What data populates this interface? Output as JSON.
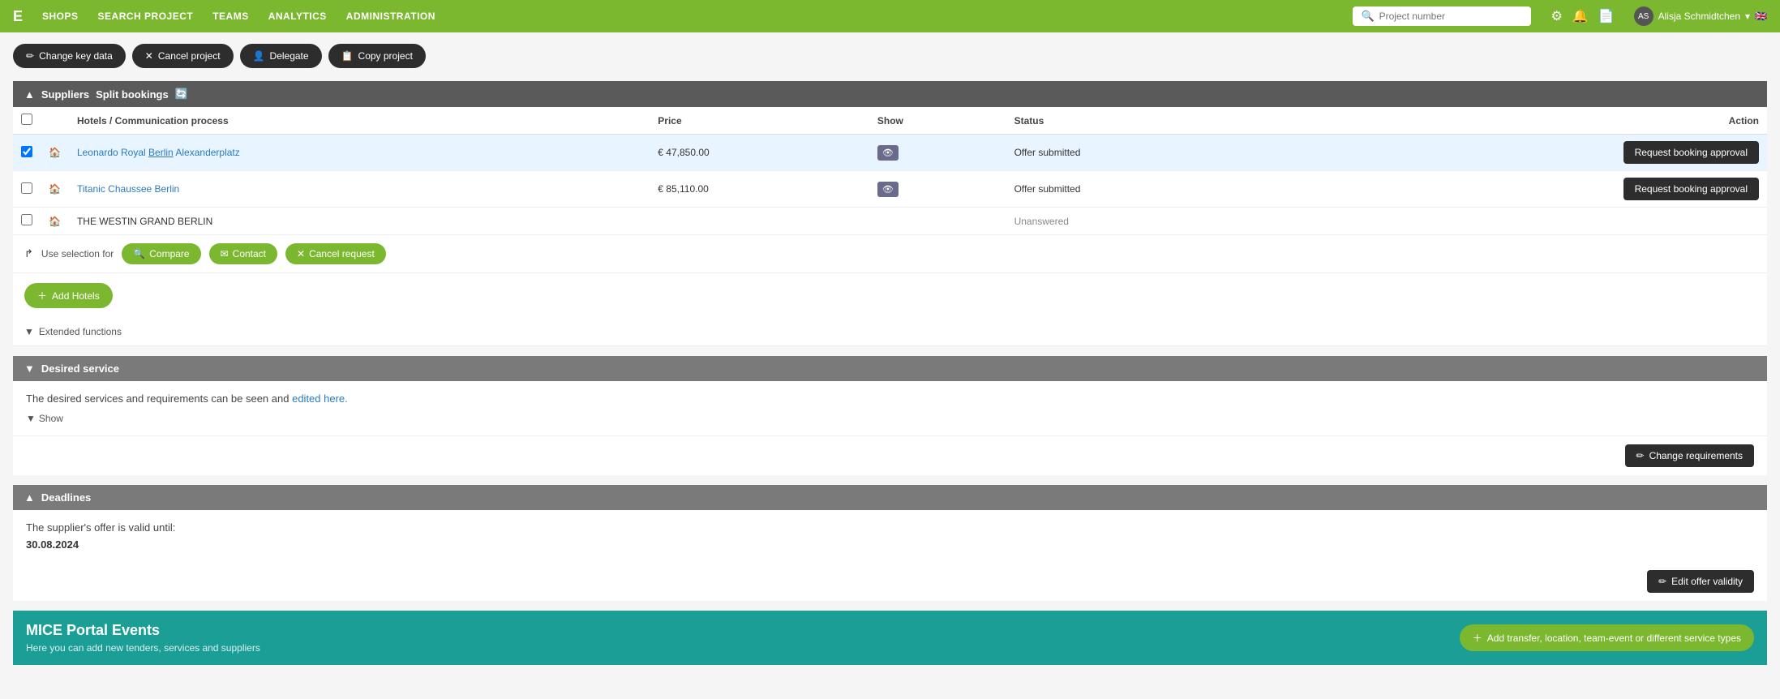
{
  "navbar": {
    "brand": "E",
    "links": [
      "SHOPS",
      "SEARCH PROJECT",
      "TEAMS",
      "ANALYTICS",
      "ADMINISTRATION"
    ],
    "search_placeholder": "Project number",
    "user": "Alisja Schmidtchen",
    "icons": {
      "settings": "⚙",
      "notifications": "🔔",
      "documents": "📄",
      "flag": "🇬🇧"
    }
  },
  "toolbar": {
    "change_key_data": "Change key data",
    "cancel_project": "Cancel project",
    "delegate": "Delegate",
    "copy_project": "Copy project"
  },
  "suppliers_section": {
    "title": "Suppliers",
    "split_bookings": "Split bookings",
    "table": {
      "headers": [
        "",
        "",
        "Hotels / Communication process",
        "Price",
        "Show",
        "Status",
        "Action"
      ],
      "rows": [
        {
          "checked": true,
          "hotel": "Leonardo Royal Berlin Alexanderplatz",
          "hotel_link": "Berlin",
          "price": "€ 47,850.00",
          "status": "Offer submitted",
          "action": "Request booking approval"
        },
        {
          "checked": false,
          "hotel": "Titanic Chaussee Berlin",
          "price": "€ 85,110.00",
          "status": "Offer submitted",
          "action": "Request booking approval"
        },
        {
          "checked": false,
          "hotel": "THE WESTIN GRAND BERLIN",
          "price": "",
          "status": "Unanswered",
          "action": ""
        }
      ]
    },
    "selection_label": "Use selection for",
    "selection_buttons": {
      "compare": "Compare",
      "contact": "Contact",
      "cancel_request": "Cancel request"
    },
    "add_hotels": "Add Hotels"
  },
  "extended_functions": {
    "label": "Extended functions"
  },
  "desired_service": {
    "title": "Desired service",
    "text_part1": "The desired services and requirements can be seen and",
    "text_link": "edited here.",
    "show_label": "Show",
    "change_requirements": "Change requirements"
  },
  "deadlines": {
    "title": "Deadlines",
    "offer_valid_label": "The supplier's offer is valid until:",
    "offer_date": "30.08.2024",
    "edit_offer": "Edit offer validity"
  },
  "mice_portal": {
    "title": "MICE Portal Events",
    "subtitle": "Here you can add new tenders, services and suppliers",
    "add_button": "Add transfer, location, team-event or different service types"
  }
}
